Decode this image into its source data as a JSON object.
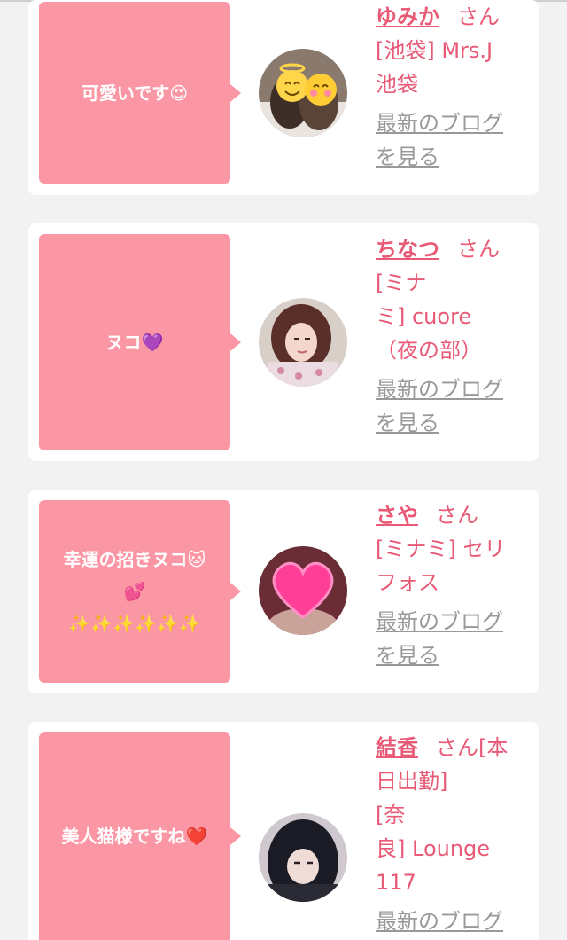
{
  "cards": [
    {
      "message": "可愛いです😍",
      "name": "ゆみか",
      "honorific": "さん",
      "shop_lines": [
        "[池袋] Mrs.J",
        "池袋"
      ],
      "blog_lines": [
        "最新のブログ",
        "を見る"
      ]
    },
    {
      "message": "ヌコ💜",
      "name": "ちなつ",
      "honorific": "さん",
      "shop_lines": [
        "[ミナ",
        "ミ] cuore",
        "（夜の部）"
      ],
      "blog_lines": [
        "最新のブログ",
        "を見る"
      ]
    },
    {
      "message_lines": [
        "幸運の招きヌコ🐱",
        "💕",
        "✨✨✨✨✨✨"
      ],
      "name": "さや",
      "honorific": "さん",
      "shop_lines": [
        "[ミナミ] セリ",
        "フォス"
      ],
      "blog_lines": [
        "最新のブログ",
        "を見る"
      ]
    },
    {
      "message": "美人猫様ですね❤️",
      "name": "結香",
      "honorific": "さん[本",
      "shop_lines": [
        "日出勤]",
        "[奈",
        "良] Lounge",
        "117"
      ],
      "blog_lines": [
        "最新のブログ"
      ]
    }
  ],
  "colors": {
    "accent": "#e85a76",
    "bubble": "#fb97a5",
    "link_gray": "#999999",
    "background": "#f2f2f2"
  }
}
